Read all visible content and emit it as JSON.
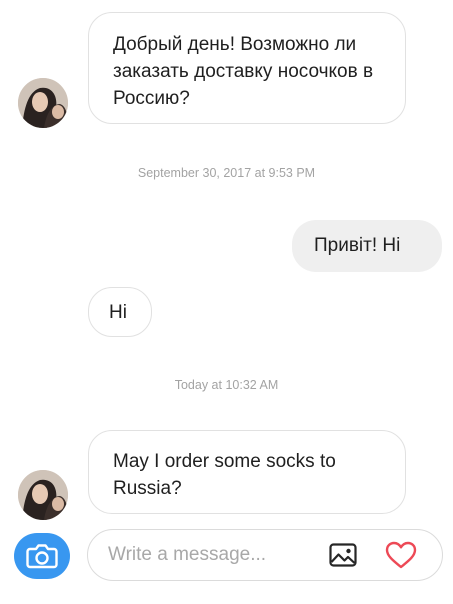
{
  "conversation": {
    "messages": [
      {
        "sender": "them",
        "text": "Добрый день! Возможно ли заказать доставку носочков в Россию?"
      },
      {
        "type": "timestamp",
        "text": "September 30, 2017 at 9:53 PM"
      },
      {
        "sender": "me",
        "text": "Привіт! Hi"
      },
      {
        "sender": "them",
        "text": "Hi"
      },
      {
        "type": "timestamp",
        "text": "Today at 10:32 AM"
      },
      {
        "sender": "them",
        "text": "May I order some socks to Russia?"
      }
    ]
  },
  "composer": {
    "placeholder": "Write a message...",
    "icons": [
      "camera-icon",
      "image-icon",
      "heart-icon"
    ]
  },
  "colors": {
    "accent": "#3897f0",
    "outgoing_bubble": "#efefef",
    "incoming_border": "#e1e1e1",
    "timestamp_text": "#a3a3a3"
  }
}
